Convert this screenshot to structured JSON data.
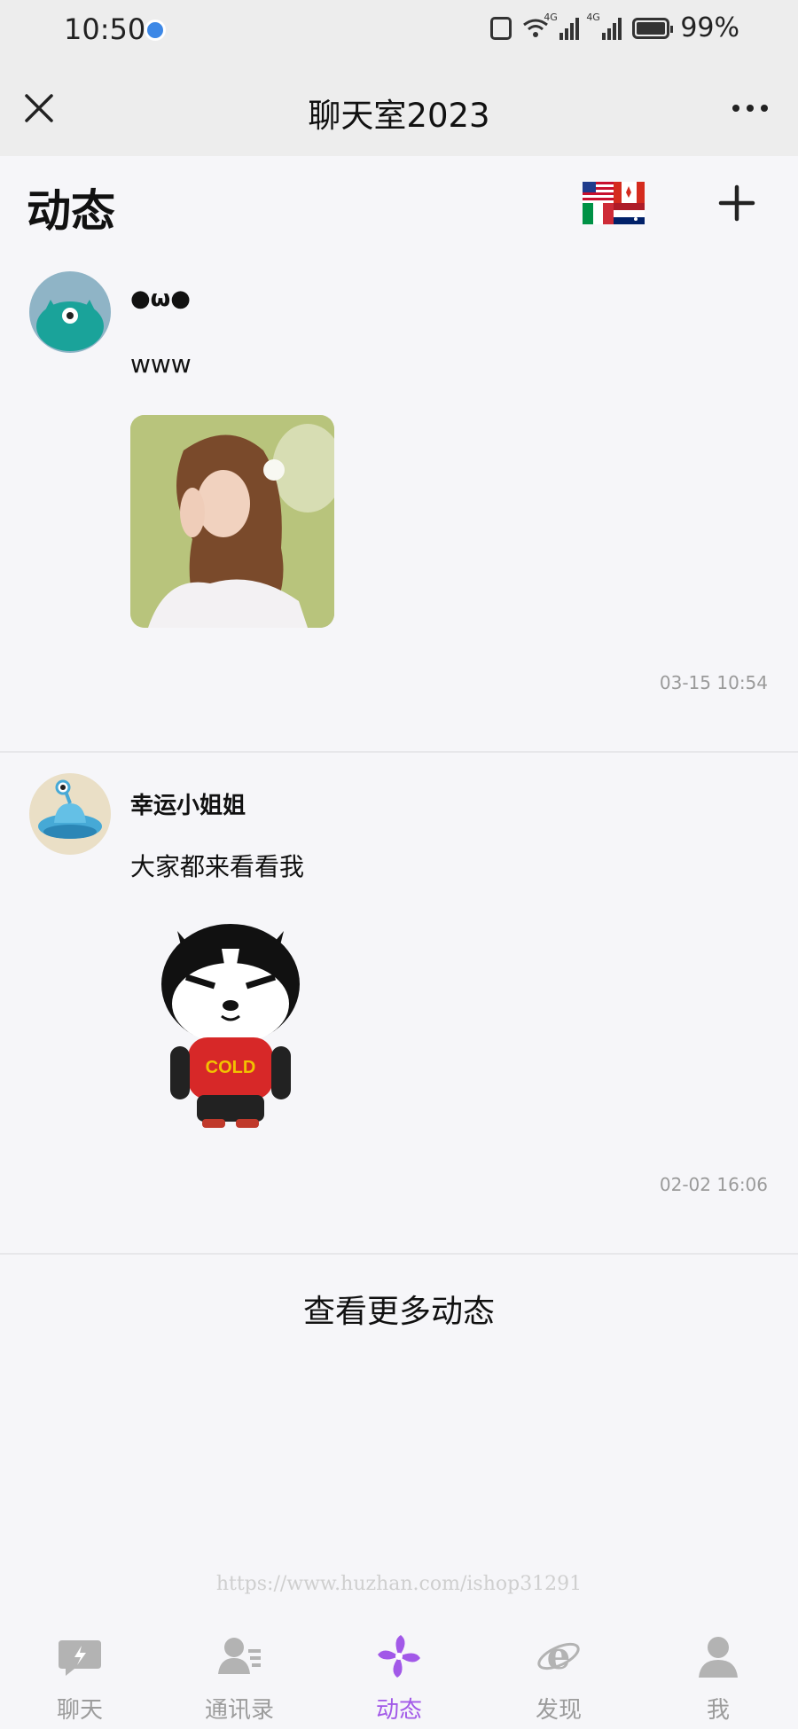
{
  "status_bar": {
    "time": "10:50",
    "net1": "4G",
    "net2": "4G",
    "battery": "99%"
  },
  "title_bar": {
    "title": "聊天室2023",
    "close_icon": "close-icon",
    "more_icon": "more-icon"
  },
  "header": {
    "title": "动态",
    "flags_icon": "flags-icon",
    "add_icon": "plus-icon"
  },
  "posts": [
    {
      "author": "●ω●",
      "text": "www",
      "media": "photo",
      "time": "03-15 10:54"
    },
    {
      "author": "幸运小姐姐",
      "text": "大家都来看看我",
      "media": "cartoon",
      "sticker_text": "COLD",
      "time": "02-02 16:06"
    }
  ],
  "load_more": "查看更多动态",
  "watermark": "https://www.huzhan.com/ishop31291",
  "nav": {
    "items": [
      {
        "label": "聊天",
        "icon": "chat-icon",
        "active": false
      },
      {
        "label": "通讯录",
        "icon": "contacts-icon",
        "active": false
      },
      {
        "label": "动态",
        "icon": "moments-icon",
        "active": true
      },
      {
        "label": "发现",
        "icon": "discover-icon",
        "active": false
      },
      {
        "label": "我",
        "icon": "me-icon",
        "active": false
      }
    ]
  },
  "colors": {
    "accent": "#a259e8",
    "inactive": "#9c9c9c",
    "background": "#f6f6f9",
    "bar": "#ededed"
  }
}
